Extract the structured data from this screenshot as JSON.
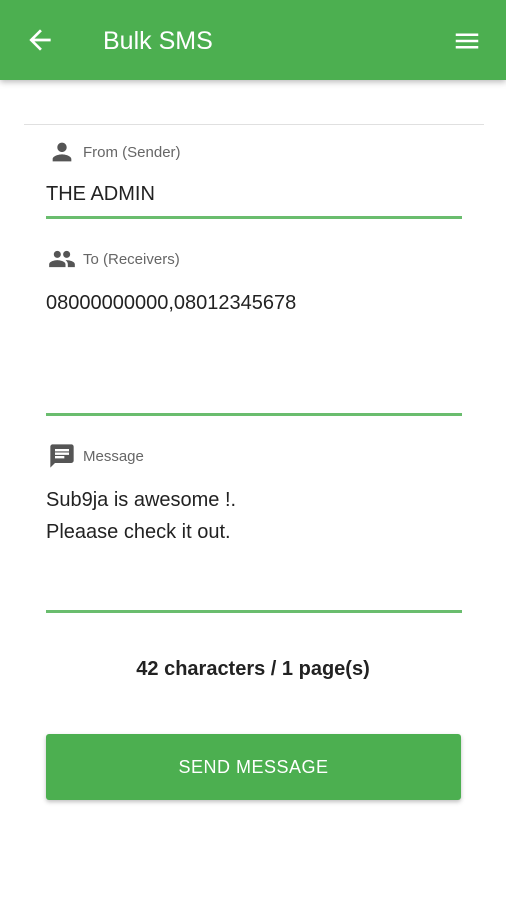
{
  "app_bar": {
    "title": "Bulk SMS",
    "back_icon": "arrow-left-icon",
    "menu_icon": "hamburger-menu-icon",
    "color": "#4caf50"
  },
  "form": {
    "from": {
      "label": "From (Sender)",
      "value": "THE ADMIN",
      "icon": "person-icon"
    },
    "to": {
      "label": "To (Receivers)",
      "value": "08000000000,08012345678",
      "icon": "people-icon"
    },
    "message": {
      "label": "Message",
      "value": "Sub9ja is awesome !.\nPleaase check it out.",
      "icon": "message-icon"
    }
  },
  "counter": {
    "text": "42 characters / 1 page(s)"
  },
  "send_button": {
    "label": "SEND MESSAGE"
  },
  "colors": {
    "accent": "#4caf50",
    "underline": "#6abd6e"
  }
}
